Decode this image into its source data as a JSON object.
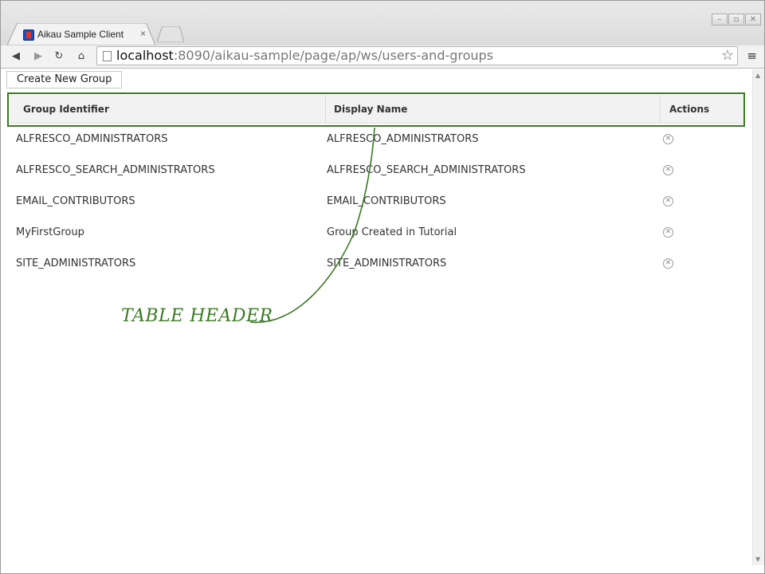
{
  "browser": {
    "tab_title": "Aikau Sample Client",
    "tab_close": "×",
    "url_host": "localhost",
    "url_rest": ":8090/aikau-sample/page/ap/ws/users-and-groups",
    "window_controls": [
      "–",
      "▫",
      "✕"
    ]
  },
  "page": {
    "create_button_label": "Create New Group",
    "table": {
      "headers": [
        "Group Identifier",
        "Display Name",
        "Actions"
      ],
      "rows": [
        {
          "id": "ALFRESCO_ADMINISTRATORS",
          "display": "ALFRESCO_ADMINISTRATORS"
        },
        {
          "id": "ALFRESCO_SEARCH_ADMINISTRATORS",
          "display": "ALFRESCO_SEARCH_ADMINISTRATORS"
        },
        {
          "id": "EMAIL_CONTRIBUTORS",
          "display": "EMAIL_CONTRIBUTORS"
        },
        {
          "id": "MyFirstGroup",
          "display": "Group Created in Tutorial"
        },
        {
          "id": "SITE_ADMINISTRATORS",
          "display": "SITE_ADMINISTRATORS"
        }
      ],
      "delete_icon": "remove-circle-icon"
    }
  },
  "annotation": {
    "label": "TABLE HEADER",
    "color": "#3b7a24"
  }
}
